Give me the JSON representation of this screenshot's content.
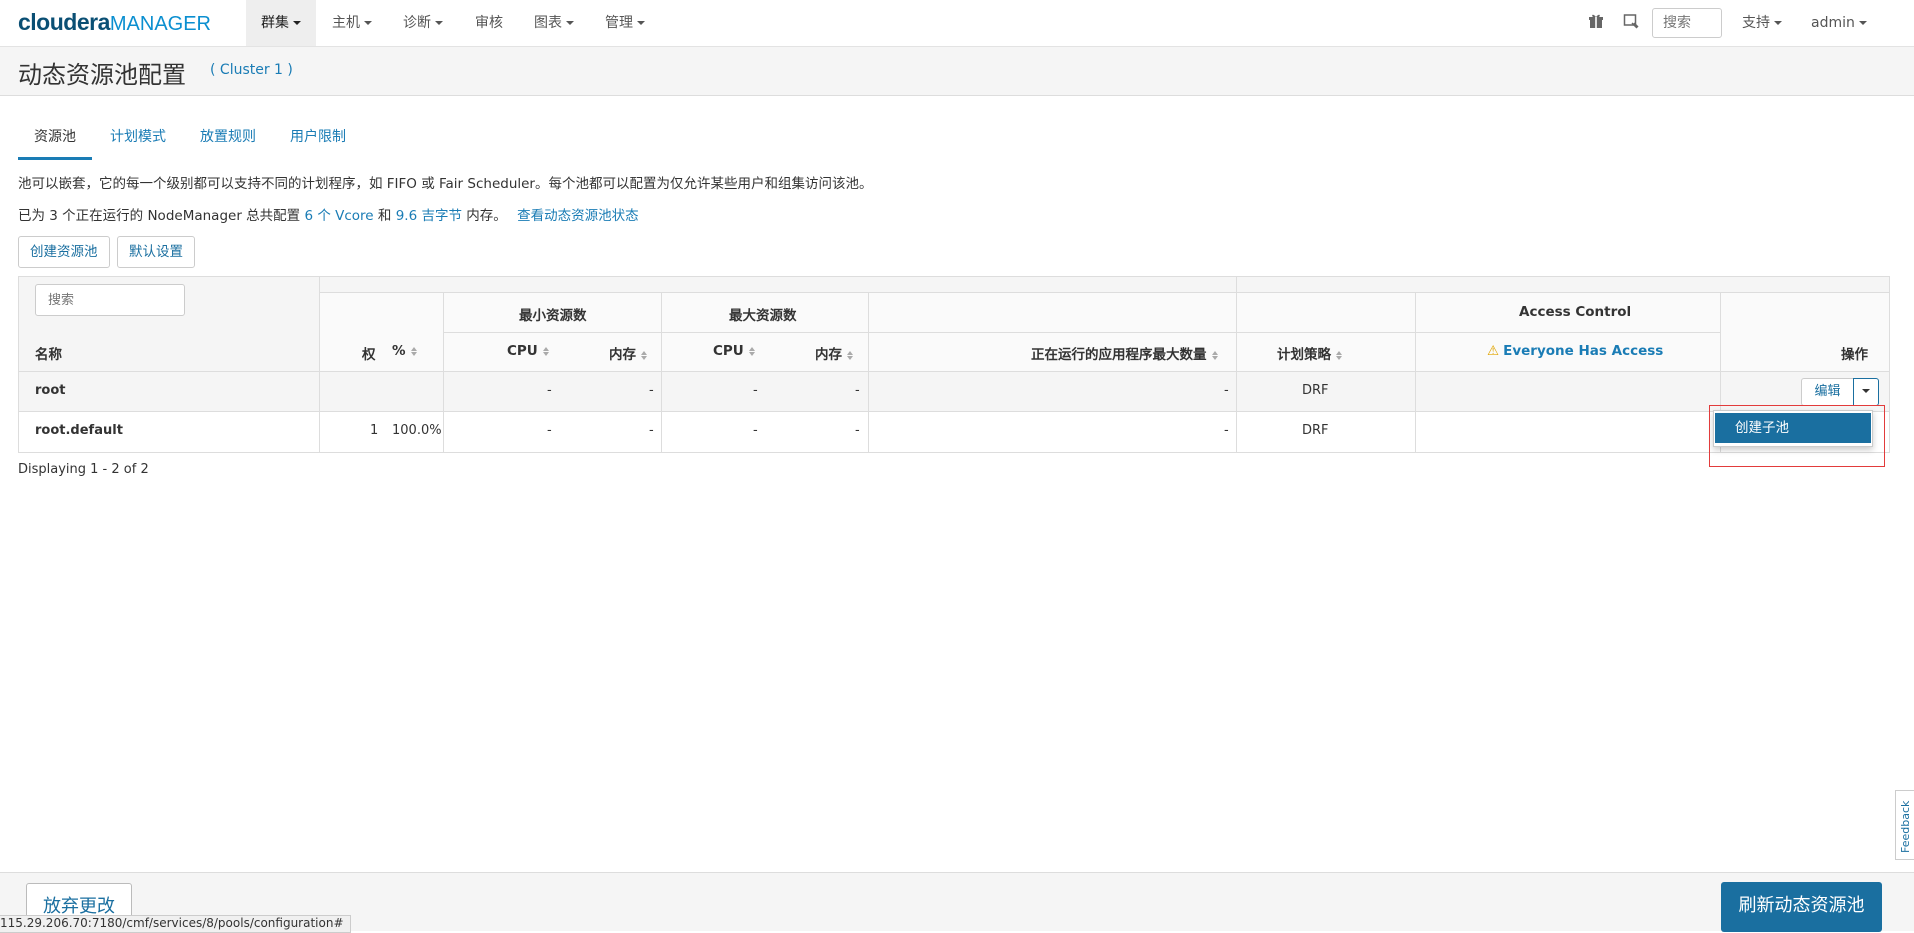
{
  "topnav": {
    "logo_part1": "cloudera",
    "logo_part2": "MANAGER",
    "items": [
      "群集",
      "主机",
      "诊断",
      "审核",
      "图表",
      "管理"
    ],
    "search_placeholder": "搜索",
    "support_label": "支持",
    "user_label": "admin"
  },
  "page": {
    "title": "动态资源池配置",
    "cluster": "( Cluster 1 )"
  },
  "tabs": [
    "资源池",
    "计划模式",
    "放置规则",
    "用户限制"
  ],
  "description": "池可以嵌套，它的每一个级别都可以支持不同的计划程序，如 FIFO 或 Fair Scheduler。每个池都可以配置为仅允许某些用户和组集访问该池。",
  "summary": {
    "prefix": "已为 3 个正在运行的 NodeManager 总共配置",
    "vcore": "6 个 Vcore",
    "and": "和",
    "memory": "9.6 吉字节",
    "suffix": "内存。",
    "status_link": "查看动态资源池状态"
  },
  "actions": {
    "create_pool": "创建资源池",
    "defaults": "默认设置"
  },
  "table": {
    "search_placeholder": "搜索",
    "headers": {
      "name": "名称",
      "weight": "权",
      "percent": "%",
      "min_resources": "最小资源数",
      "max_resources": "最大资源数",
      "cpu": "CPU",
      "memory": "内存",
      "max_running_apps": "正在运行的应用程序最大数量",
      "policy": "计划策略",
      "access_control": "Access Control",
      "everyone_access": "Everyone Has Access",
      "operations": "操作"
    },
    "rows": [
      {
        "name": "root",
        "weight": "",
        "percent": "",
        "min_cpu": "-",
        "min_mem": "-",
        "max_cpu": "-",
        "max_mem": "-",
        "max_apps": "-",
        "policy": "DRF"
      },
      {
        "name": "root.default",
        "weight": "1",
        "percent": "100.0%",
        "min_cpu": "-",
        "min_mem": "-",
        "max_cpu": "-",
        "max_mem": "-",
        "max_apps": "-",
        "policy": "DRF"
      }
    ],
    "edit_label": "编辑",
    "footer": "Displaying 1 - 2 of 2"
  },
  "dropdown": {
    "create_child_pool": "创建子池"
  },
  "footer": {
    "discard": "放弃更改",
    "refresh": "刷新动态资源池"
  },
  "status_url": "115.29.206.70:7180/cmf/services/8/pools/configuration#",
  "feedback": "Feedback",
  "colors": {
    "brand_dark": "#0a4f74",
    "brand_light": "#0b8fd0",
    "link": "#1a7cb5",
    "primary_button": "#1a6fa0",
    "warning": "#e0a400",
    "highlight_box": "#e23b3b"
  }
}
